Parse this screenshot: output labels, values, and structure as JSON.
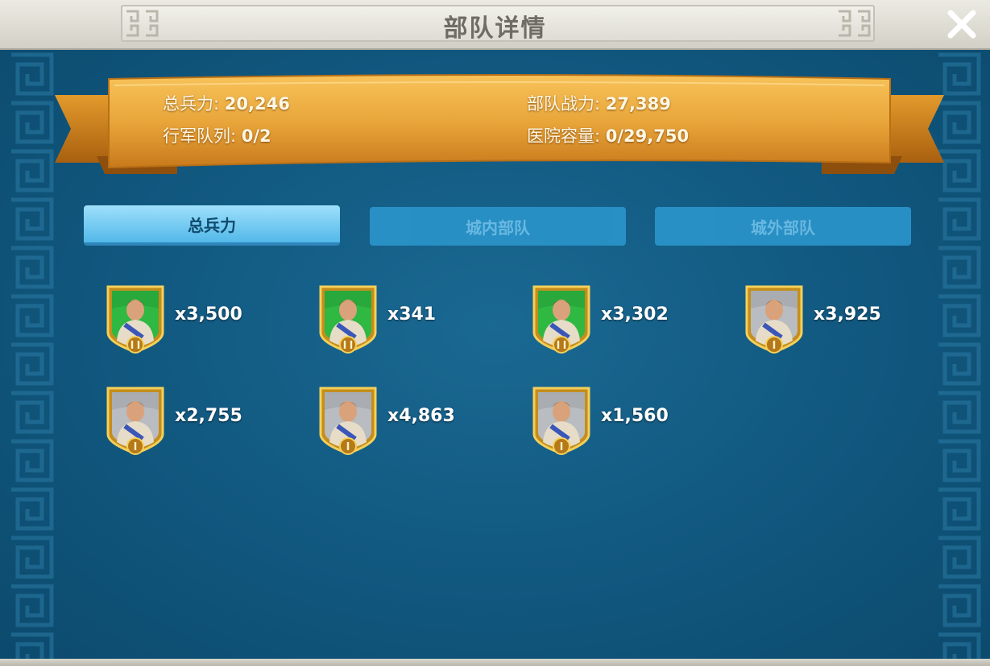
{
  "window": {
    "title": "部队详情",
    "close_icon": "close-icon"
  },
  "stats": {
    "total_troops_label": "总兵力:",
    "total_troops_value": "20,246",
    "power_label": "部队战力:",
    "power_value": "27,389",
    "march_label": "行军队列:",
    "march_value": "0/2",
    "hospital_label": "医院容量:",
    "hospital_value": "0/29,750"
  },
  "tabs": [
    {
      "label": "总兵力",
      "active": true
    },
    {
      "label": "城内部队",
      "active": false
    },
    {
      "label": "城外部队",
      "active": false
    }
  ],
  "troops": [
    {
      "icon": "heavy-infantry-portrait-icon",
      "tier": "II",
      "count": "x3,500",
      "background": "green"
    },
    {
      "icon": "cavalry-portrait-icon",
      "tier": "II",
      "count": "x341",
      "background": "green"
    },
    {
      "icon": "archer-portrait-icon",
      "tier": "II",
      "count": "x3,302",
      "background": "green"
    },
    {
      "icon": "cavalry-rider-portrait-icon",
      "tier": "I",
      "count": "x3,925",
      "background": "gray"
    },
    {
      "icon": "infantry-portrait-icon",
      "tier": "I",
      "count": "x2,755",
      "background": "gray"
    },
    {
      "icon": "archer-portrait-icon",
      "tier": "I",
      "count": "x4,863",
      "background": "gray"
    },
    {
      "icon": "siege-ram-portrait-icon",
      "tier": "I",
      "count": "x1,560",
      "background": "gray"
    }
  ],
  "colors": {
    "panel_blue": "#125a82",
    "banner_gold": "#e9a63a",
    "tab_active": "#63c3ef",
    "tab_inactive": "#2a92c8",
    "shield_gold": "#e3b83a",
    "portrait_green": "#2fb842"
  }
}
